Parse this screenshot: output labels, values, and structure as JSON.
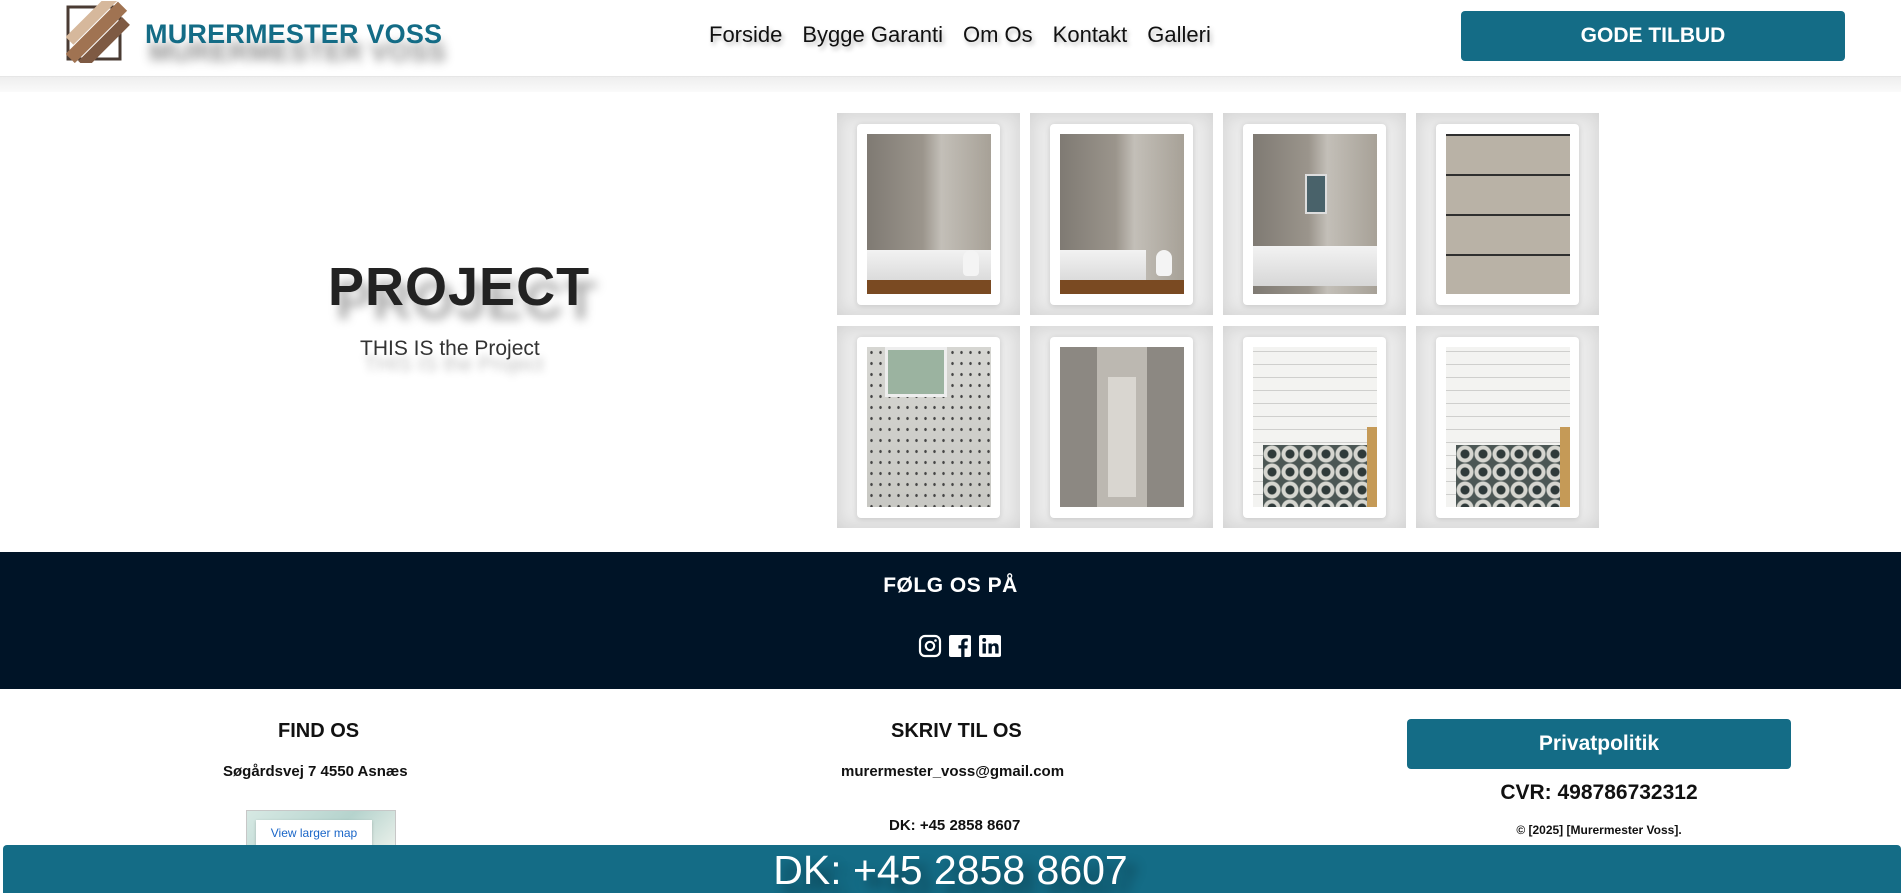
{
  "header": {
    "brand": "MURERMESTER VOSS",
    "nav": [
      "Forside",
      "Bygge Garanti",
      "Om Os",
      "Kontakt",
      "Galleri"
    ],
    "cta_label": "GODE TILBUD"
  },
  "hero": {
    "title": "PROJECT",
    "subtitle": "THIS IS the Project"
  },
  "gallery": {
    "images": [
      "bathroom-tub-grey-tiles",
      "bathroom-tub-toilet-grey-tiles",
      "bathroom-tub-window-grey-tiles",
      "floor-tiles-installation",
      "speckled-tile-shower-window",
      "grey-tile-hallway-toilet",
      "subway-tile-patterned-floor",
      "subway-tile-patterned-floor-bench"
    ]
  },
  "social": {
    "title": "FØLG OS PÅ",
    "icons": [
      "instagram-icon",
      "facebook-icon",
      "linkedin-icon"
    ]
  },
  "footer": {
    "find": {
      "title": "FIND OS",
      "address": "Søgårdsvej 7 4550 Asnæs",
      "map_button": "View larger map"
    },
    "write": {
      "title": "SKRIV TIL OS",
      "email": "murermester_voss@gmail.com",
      "phone": "DK: +45 2858 8607"
    },
    "legal": {
      "privacy_label": "Privatpolitik",
      "cvr": "CVR: 498786732312",
      "copyright": "© [2025] [Murermester Voss]."
    }
  },
  "phone_bar": {
    "text": "DK: +45 2858 8607"
  },
  "colors": {
    "brand": "#146c86",
    "footer_band": "#001427"
  }
}
